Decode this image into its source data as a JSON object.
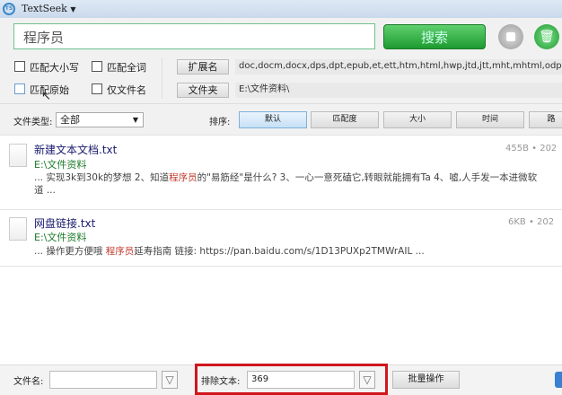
{
  "app": {
    "title": "TextSeek",
    "logo": "TS"
  },
  "search": {
    "query": "程序员",
    "button": "搜索"
  },
  "options": {
    "match_case": "匹配大小写",
    "match_word": "匹配全词",
    "match_raw": "匹配原始",
    "filename_only": "仅文件名"
  },
  "ext": {
    "label": "扩展名",
    "value": "doc,docm,docx,dps,dpt,epub,et,ett,htm,html,hwp,jtd,jtt,mht,mhtml,odp,ods,odt,ofd,"
  },
  "folder": {
    "label": "文件夹",
    "value": "E:\\文件资料\\"
  },
  "filetype": {
    "label": "文件类型:",
    "value": "全部"
  },
  "sort": {
    "label": "排序:",
    "buttons": [
      "默认",
      "匹配度",
      "大小",
      "时间",
      "路"
    ]
  },
  "results": [
    {
      "title": "新建文本文档.txt",
      "path": "E:\\文件资料",
      "pre": "... 实现3k到30k的梦想 2、知道",
      "hl": "程序员",
      "post": "的\"易筋经\"是什么? 3、一心一意死磕它,转眼就能拥有Ta 4、嘘,人手发一本进微软",
      "line2": "道 ...",
      "meta": "455B • 202"
    },
    {
      "title": "网盘链接.txt",
      "path": "E:\\文件资料",
      "pre": "... 操作更方便哦 ",
      "hl": "程序员",
      "post": "延寿指南 链接: https://pan.baidu.com/s/1D13PUXp2TMWrAIL ...",
      "line2": "",
      "meta": "6KB • 202"
    }
  ],
  "bottom": {
    "filename_label": "文件名:",
    "filename_value": "",
    "exclude_label": "排除文本:",
    "exclude_value": "369",
    "batch": "批量操作"
  }
}
